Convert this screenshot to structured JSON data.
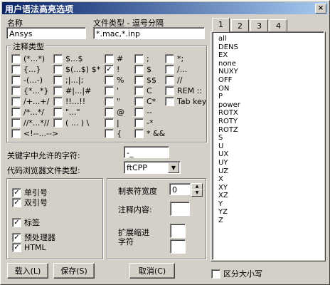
{
  "window": {
    "title": "用户语法高亮选项",
    "close": "×"
  },
  "name": {
    "label": "名称",
    "value": "Ansys"
  },
  "filetype": {
    "label": "文件类型 - 逗号分隔",
    "value": "*.mac,*.inp"
  },
  "comment_types": {
    "title": "注释类型",
    "col1": [
      {
        "label": "(*...*)",
        "checked": false
      },
      {
        "label": "{...}",
        "checked": false
      },
      {
        "label": "-(...-)",
        "checked": false
      },
      {
        "label": "{*...*}",
        "checked": false
      },
      {
        "label": "/+...+/",
        "checked": false
      },
      {
        "label": "/*...*/",
        "checked": false
      },
      {
        "label": "//*...*//",
        "checked": false
      },
      {
        "label": "<!--...-->",
        "checked": false
      }
    ],
    "col2": [
      {
        "label": "$...$",
        "checked": false
      },
      {
        "label": "$(...$) $*",
        "checked": false
      },
      {
        "label": ";|...|;",
        "checked": false
      },
      {
        "label": "#|...|#",
        "checked": false
      },
      {
        "label": "!!...!!",
        "checked": false
      },
      {
        "label": "\"...\"",
        "checked": false
      },
      {
        "label": "( ... ) \\",
        "checked": false
      }
    ],
    "col3": [
      {
        "label": "#",
        "checked": false
      },
      {
        "label": "!",
        "checked": true
      },
      {
        "label": "%",
        "checked": false
      },
      {
        "label": "'",
        "checked": false
      },
      {
        "label": "\"",
        "checked": false
      },
      {
        "label": "@",
        "checked": false
      },
      {
        "label": "|",
        "checked": false
      },
      {
        "label": "{",
        "checked": false
      }
    ],
    "col4": [
      {
        "label": ";",
        "checked": false
      },
      {
        "label": "$",
        "checked": false
      },
      {
        "label": "$$",
        "checked": false
      },
      {
        "label": "C",
        "checked": false
      },
      {
        "label": "C*",
        "checked": false
      },
      {
        "label": "--",
        "checked": false
      },
      {
        "label": "-*",
        "checked": false
      },
      {
        "label": "* &&",
        "checked": false
      }
    ],
    "col5": [
      {
        "label": "*;",
        "checked": false
      },
      {
        "label": "/...",
        "checked": false
      },
      {
        "label": "//",
        "checked": false
      },
      {
        "label": "REM ::",
        "checked": false
      },
      {
        "label": "Tab key",
        "checked": false
      }
    ]
  },
  "keyword_chars": {
    "label": "关键字中允许的字符:",
    "value": "-_"
  },
  "browser_type": {
    "label": "代码浏览器文件类型:",
    "value": "ftCPP",
    "arrow": "▼"
  },
  "options": [
    {
      "label": "单引号",
      "checked": true
    },
    {
      "label": "双引号",
      "checked": true
    },
    {
      "label": "标签",
      "checked": true
    },
    {
      "label": "预处理器",
      "checked": true
    },
    {
      "label": "HTML",
      "checked": true
    }
  ],
  "tab_width": {
    "label": "制表符宽度",
    "value": "0"
  },
  "comment_content": {
    "label": "注释内容:",
    "value": ""
  },
  "expand_indent": {
    "label_line1": "扩展缩进",
    "label_line2": "字符",
    "value1": "",
    "value2": ""
  },
  "tabs": [
    "1",
    "2",
    "3",
    "4"
  ],
  "keywords": [
    "all",
    "DENS",
    "EX",
    "none",
    "NUXY",
    "OFF",
    "ON",
    "P",
    "power",
    "ROTX",
    "ROTY",
    "ROTZ",
    "S",
    "U",
    "UX",
    "UY",
    "UZ",
    "X",
    "XY",
    "XZ",
    "Y",
    "YZ",
    "Z"
  ],
  "case_sensitive": {
    "label": "区分大小写",
    "checked": false
  },
  "buttons": {
    "load": "载入(L)",
    "save": "保存(S)",
    "cancel": "取消(C)"
  }
}
